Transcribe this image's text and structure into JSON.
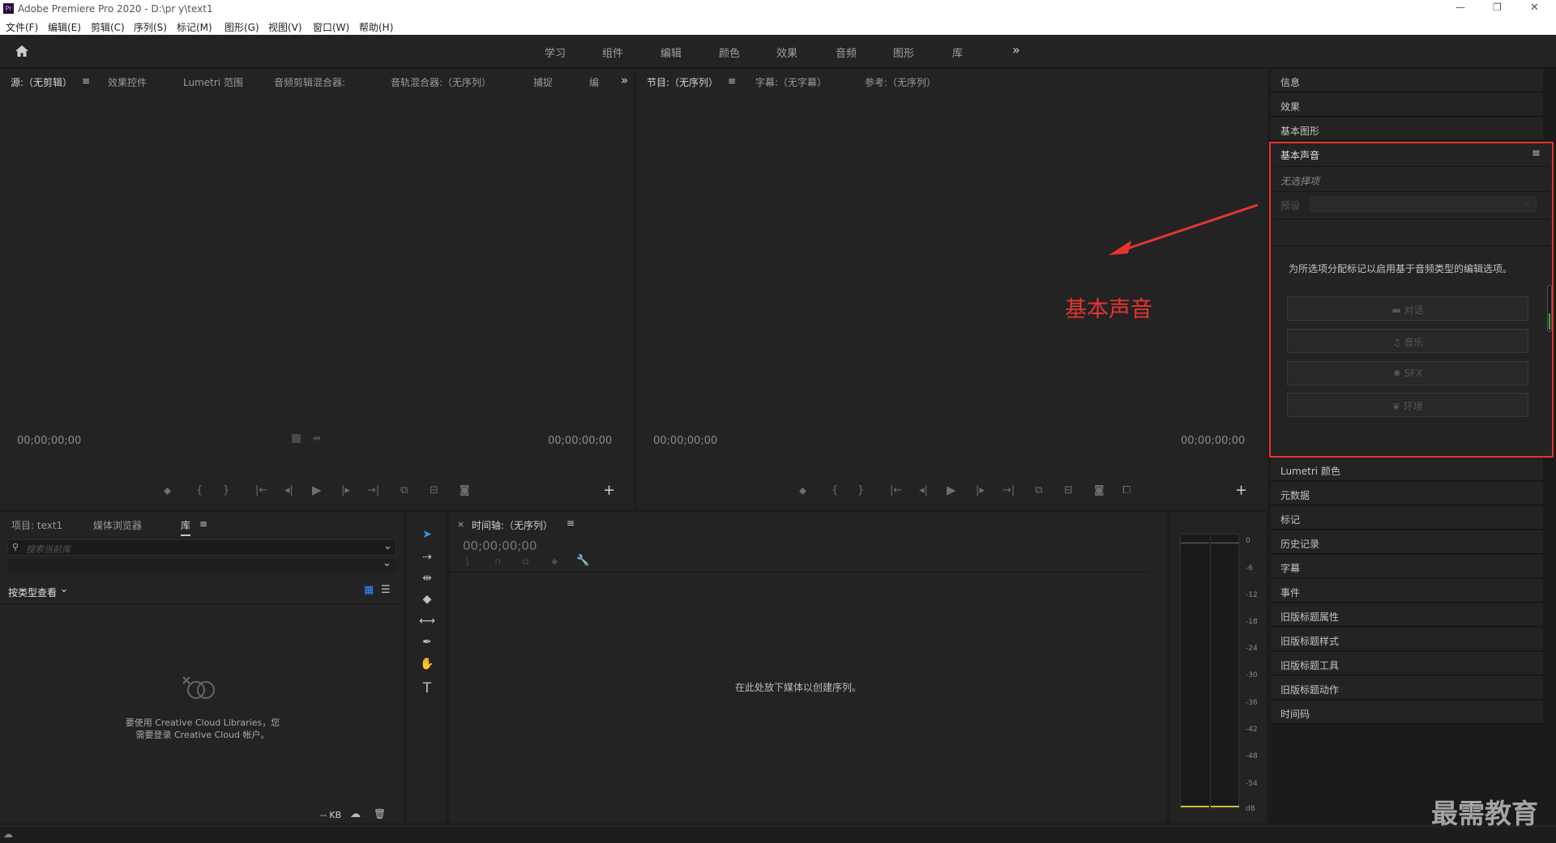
{
  "window": {
    "title": "Adobe Premiere Pro 2020 - D:\\pr y\\text1",
    "app_icon": "Pr",
    "controls": [
      "—",
      "❐",
      "✕"
    ]
  },
  "menu": [
    "文件(F)",
    "编辑(E)",
    "剪辑(C)",
    "序列(S)",
    "标记(M)",
    "图形(G)",
    "视图(V)",
    "窗口(W)",
    "帮助(H)"
  ],
  "workspaces": {
    "items": [
      "学习",
      "组件",
      "编辑",
      "颜色",
      "效果",
      "音频",
      "图形",
      "库"
    ],
    "more": "»"
  },
  "source_panel": {
    "tabs": [
      "源:（无剪辑）",
      "效果控件",
      "Lumetri 范围",
      "音频剪辑混合器:",
      "音轨混合器:（无序列）",
      "捕捉",
      "编"
    ],
    "timecode_left": "00;00;00;00",
    "timecode_right": "00;00;00;00"
  },
  "program_panel": {
    "tabs": [
      "节目:（无序列）",
      "字幕:（无字幕）",
      "参考:（无序列）"
    ],
    "timecode_left": "00;00;00;00",
    "timecode_right": "00;00;00;00"
  },
  "annotation": {
    "label": "基本声音",
    "color": "#e8342f"
  },
  "right_panel": {
    "top_items": [
      "信息",
      "效果",
      "基本图形"
    ],
    "essential_sound": {
      "title": "基本声音",
      "no_selection": "无选择项",
      "preset_label": "预设",
      "hint": "为所选项分配标记以启用基于音频类型的编辑选项。",
      "buttons": [
        "对话",
        "音乐",
        "SFX",
        "环境"
      ]
    },
    "bottom_items": [
      "Lumetri 颜色",
      "元数据",
      "标记",
      "历史记录",
      "字幕",
      "事件",
      "旧版标题属性",
      "旧版标题样式",
      "旧版标题工具",
      "旧版标题动作",
      "时间码"
    ]
  },
  "project_panel": {
    "tabs": [
      "项目: text1",
      "媒体浏览器",
      "库"
    ],
    "search_placeholder": "搜索当前库",
    "view_by": "按类型查看",
    "cc_message_line1": "要使用 Creative Cloud Libraries，您",
    "cc_message_line2": "需要登录 Creative Cloud 帐户。",
    "kb": "-- KB"
  },
  "timeline": {
    "title": "时间轴:（无序列）",
    "timecode": "00;00;00;00",
    "drop_hint": "在此处放下媒体以创建序列。"
  },
  "audio_meter": {
    "ticks": [
      "0",
      "-6",
      "-12",
      "-18",
      "-24",
      "-30",
      "-36",
      "-42",
      "-48",
      "-54",
      "dB"
    ]
  },
  "watermark": "最需教育"
}
